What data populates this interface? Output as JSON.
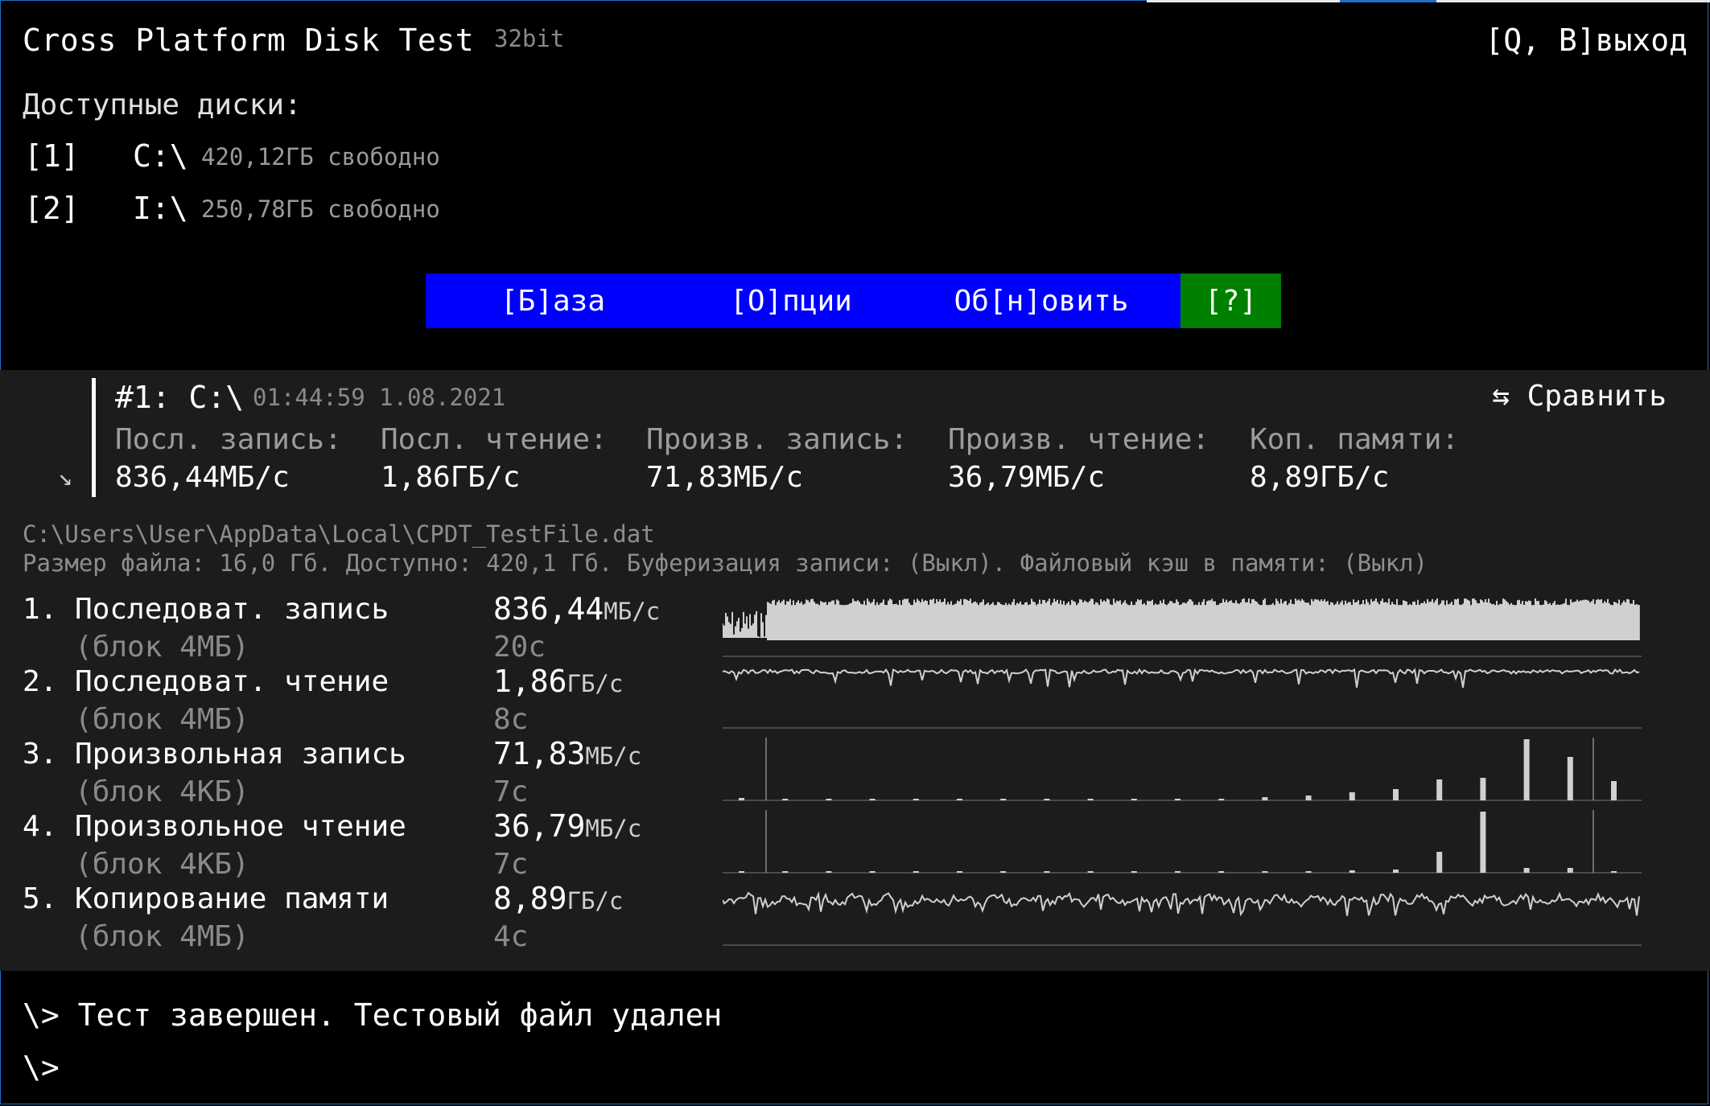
{
  "app": {
    "title": "Cross Platform Disk Test",
    "bits": "32bit",
    "quit_label": "[Q, В]выход"
  },
  "disks": {
    "heading": "Доступные диски:",
    "items": [
      {
        "key": "[1]",
        "letter": "C:\\",
        "free": "420,12ГБ свободно"
      },
      {
        "key": "[2]",
        "letter": "I:\\",
        "free": "250,78ГБ свободно"
      }
    ]
  },
  "menu": [
    {
      "label": "[Б]аза",
      "color": "#0000ff"
    },
    {
      "label": "[О]пции",
      "color": "#0000ff"
    },
    {
      "label": "Об[н]овить",
      "color": "#0000ff"
    },
    {
      "label": "[?]",
      "color": "#008000"
    }
  ],
  "result": {
    "header": "#1: C:\\",
    "datetime": "01:44:59 1.08.2021",
    "compare_label": "⇆ Сравнить",
    "arrow_icon": "↘",
    "columns": [
      {
        "label": "Посл. запись:",
        "value": "836,44МБ/с"
      },
      {
        "label": "Посл. чтение:",
        "value": "1,86ГБ/с"
      },
      {
        "label": "Произв. запись:",
        "value": "71,83МБ/с"
      },
      {
        "label": "Произв. чтение:",
        "value": "36,79МБ/с"
      },
      {
        "label": "Коп. памяти:",
        "value": "8,89ГБ/с"
      }
    ]
  },
  "file": {
    "path": "C:\\Users\\User\\AppData\\Local\\CPDT_TestFile.dat",
    "info": "Размер файла: 16,0 Гб. Доступно: 420,1 Гб. Буферизация записи: (Выкл). Файловый кэш в памяти: (Выкл)"
  },
  "tests": [
    {
      "name": "1. Последоват. запись",
      "block": "   (блок 4МБ)",
      "value": "836,44",
      "unit": "МБ/с",
      "time": "20с",
      "graph": "dense"
    },
    {
      "name": "2. Последоват. чтение",
      "block": "   (блок 4МБ)",
      "value": "1,86",
      "unit": "ГБ/с",
      "time": "8с",
      "graph": "flat"
    },
    {
      "name": "3. Произвольная запись",
      "block": "   (блок 4КБ)",
      "value": "71,83",
      "unit": "МБ/с",
      "time": "7с",
      "graph": "bars-write"
    },
    {
      "name": "4. Произвольное чтение",
      "block": "   (блок 4КБ)",
      "value": "36,79",
      "unit": "МБ/с",
      "time": "7с",
      "graph": "bars-read"
    },
    {
      "name": "5. Копирование памяти",
      "block": "   (блок 4МБ)",
      "value": "8,89",
      "unit": "ГБ/с",
      "time": "4с",
      "graph": "wavy"
    }
  ],
  "console": {
    "status": "\\> Тест завершен. Тестовый файл удален",
    "prompt": "\\>"
  },
  "colors": {
    "accent_blue": "#0000ff",
    "help_green": "#008000",
    "panel": "#1c1c1c",
    "graph": "#d0d0d0"
  }
}
